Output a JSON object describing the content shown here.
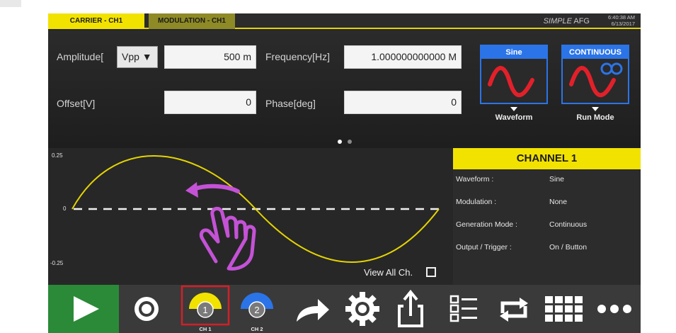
{
  "tabs": {
    "carrier": "CARRIER - CH1",
    "modulation": "MODULATION - CH1"
  },
  "app": {
    "name_italic": "SIMPLE",
    "name_rest": "AFG",
    "time": "6:40:38 AM",
    "date": "6/13/2017"
  },
  "params": {
    "amplitude_label": "Amplitude[",
    "amplitude_unit": "Vpp ▼",
    "amplitude_value": "500 m",
    "offset_label": "Offset[V]",
    "offset_value": "0",
    "frequency_label": "Frequency[Hz]",
    "frequency_value": "1.000000000000 M",
    "phase_label": "Phase[deg]",
    "phase_value": "0"
  },
  "waveform_tile": {
    "header": "Sine",
    "caption": "Waveform"
  },
  "runmode_tile": {
    "header": "CONTINUOUS",
    "caption": "Run Mode"
  },
  "plot": {
    "y_max_label": "0.25",
    "y_zero_label": "0",
    "y_min_label": "-0.25",
    "view_all_label": "View All Ch."
  },
  "channel_info": {
    "title": "CHANNEL 1",
    "rows": [
      {
        "key": "Waveform :",
        "value": "Sine"
      },
      {
        "key": "Modulation :",
        "value": "None"
      },
      {
        "key": "Generation Mode :",
        "value": "Continuous"
      },
      {
        "key": "Output / Trigger :",
        "value": "On / Button"
      }
    ]
  },
  "toolbar": {
    "ch1_number": "1",
    "ch1_label": "CH 1",
    "ch2_number": "2",
    "ch2_label": "CH 2"
  },
  "colors": {
    "accent_yellow": "#f2e200",
    "accent_blue": "#2b74e8",
    "play_green": "#2a8a38",
    "gesture_purple": "#c452d6",
    "selection_red": "#d0202a"
  },
  "icons": [
    "play-icon",
    "stop-icon",
    "channel-1-icon",
    "channel-2-icon",
    "forward-arrow-icon",
    "gear-icon",
    "export-icon",
    "list-icon",
    "repeat-icon",
    "grid-icon",
    "more-icon",
    "swipe-gesture-icon",
    "hand-icon"
  ]
}
